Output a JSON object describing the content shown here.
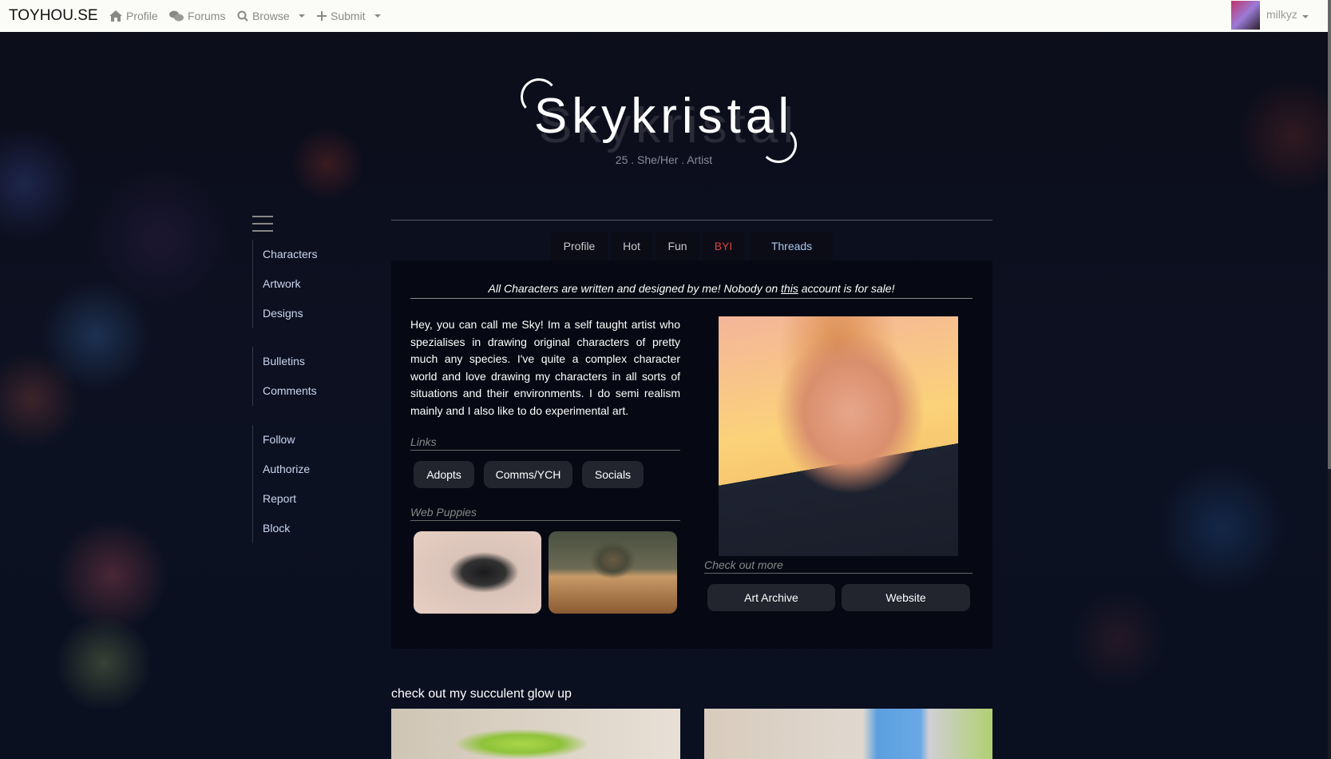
{
  "nav": {
    "brand": "TOYHOU.SE",
    "items": [
      {
        "label": "Profile",
        "icon": "home-icon"
      },
      {
        "label": "Forums",
        "icon": "comments-icon"
      },
      {
        "label": "Browse",
        "icon": "search-icon"
      },
      {
        "label": "Submit",
        "icon": "plus-icon"
      }
    ],
    "username": "milkyz"
  },
  "header": {
    "title": "Skykristal",
    "subtitle": "25 . She/Her . Artist"
  },
  "sidebar": {
    "groups": [
      [
        "Characters",
        "Artwork",
        "Designs"
      ],
      [
        "Bulletins",
        "Comments"
      ],
      [
        "Follow",
        "Authorize",
        "Report",
        "Block"
      ]
    ]
  },
  "tabs": [
    {
      "label": "Profile"
    },
    {
      "label": "Hot"
    },
    {
      "label": "Fun"
    },
    {
      "label": "BYI",
      "color": "#d9433f"
    },
    {
      "label": "Threads",
      "color": "#a9c7f0"
    }
  ],
  "content": {
    "tagline_pre": "All Characters are written and designed by me! Nobody on ",
    "tagline_link": "this",
    "tagline_post": " account is for sale!",
    "bio": "Hey, you can call me Sky! Im a self taught artist who spezialises in drawing original characters of pretty much any species. I've quite a complex character world and love drawing my characters in all sorts of situations and their environments. I do semi realism mainly and I also like to do experimental art.",
    "links_label": "Links",
    "links": [
      "Adopts",
      "Comms/YCH",
      "Socials"
    ],
    "puppies_label": "Web Puppies",
    "more_label": "Check out more",
    "more": [
      "Art Archive",
      "Website"
    ]
  },
  "section": {
    "heading": "check out my succulent glow up"
  }
}
